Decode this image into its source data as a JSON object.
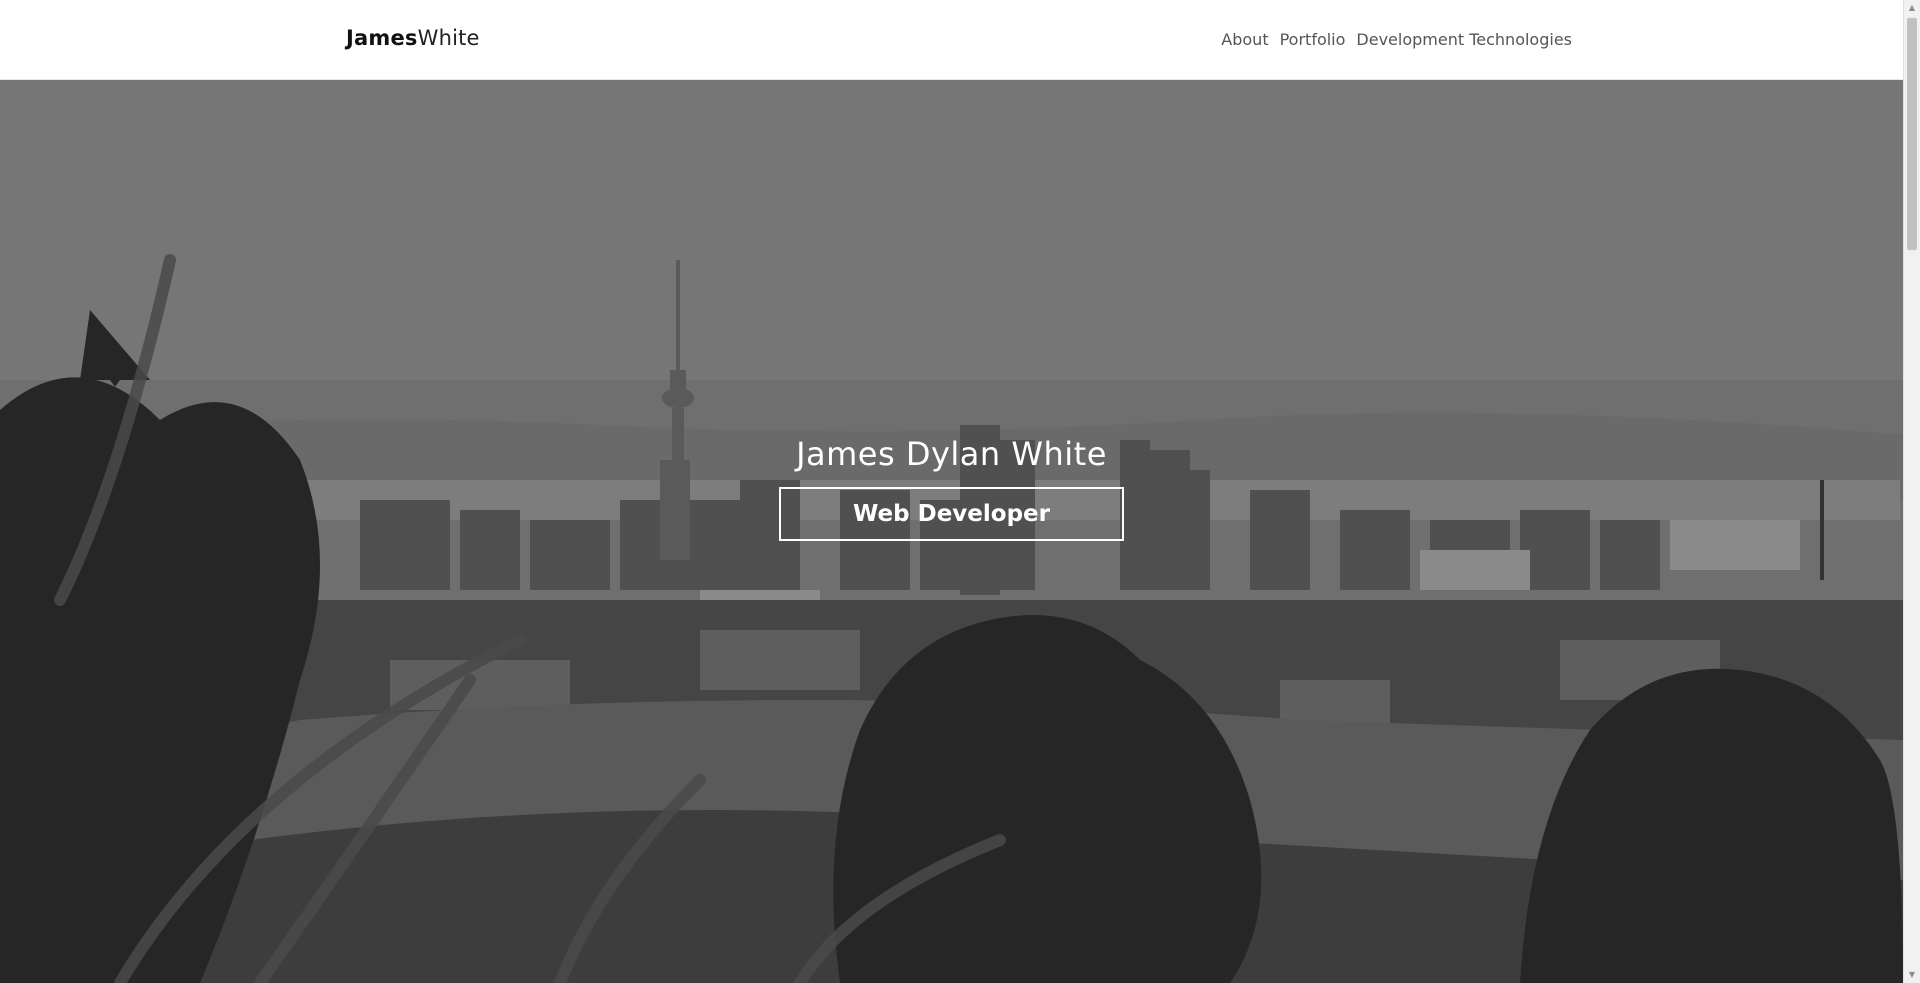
{
  "navbar": {
    "brand_bold": "James",
    "brand_light": "White",
    "links": [
      {
        "label": "About"
      },
      {
        "label": "Portfolio"
      },
      {
        "label": "Development Technologies"
      }
    ]
  },
  "hero": {
    "title": "James Dylan White",
    "role": "Web Developer",
    "background": "grayscale city skyline with tower, trees and grass"
  },
  "scrollbar": {
    "up_icon": "arrow-up-icon",
    "down_icon": "arrow-down-icon"
  },
  "colors": {
    "navbar_bg": "#ffffff",
    "hero_text": "#ffffff",
    "nav_link": "#555555"
  }
}
